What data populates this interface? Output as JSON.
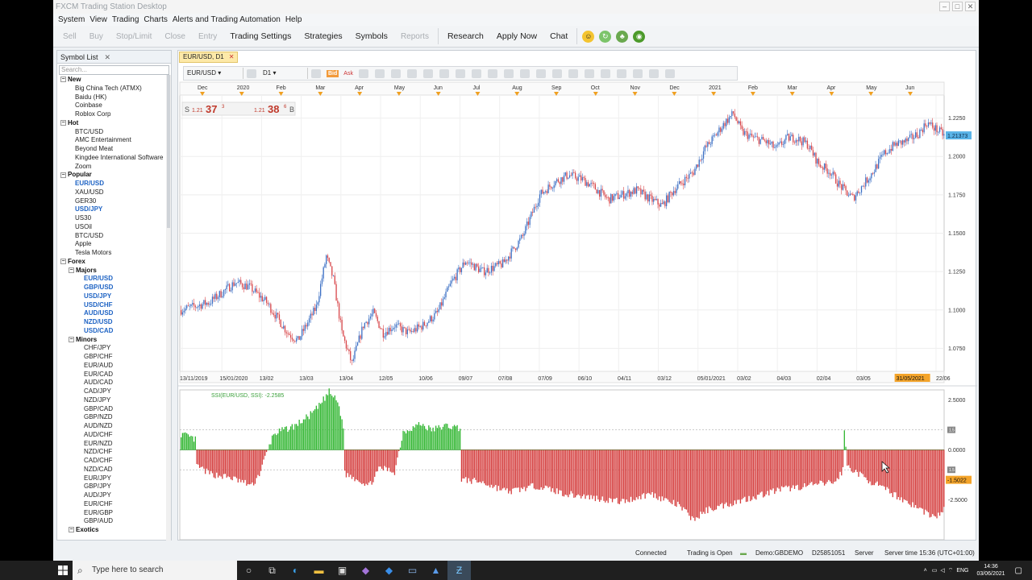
{
  "window": {
    "title": "FXCM Trading Station Desktop"
  },
  "menu": [
    "System",
    "View",
    "Trading",
    "Charts",
    "Alerts and Trading Automation",
    "Help"
  ],
  "toolbar": {
    "disabled": [
      "Sell",
      "Buy",
      "Stop/Limit",
      "Close",
      "Entry"
    ],
    "enabled1": [
      "Trading Settings",
      "Strategies",
      "Symbols"
    ],
    "disabled2": [
      "Reports"
    ],
    "enabled2": [
      "Research",
      "Apply Now",
      "Chat"
    ]
  },
  "symbol_list": {
    "tab": "Symbol List",
    "search_placeholder": "Search...",
    "tree": [
      {
        "label": "New",
        "level": 0,
        "group": true
      },
      {
        "label": "Big China Tech (ATMX)",
        "level": 2
      },
      {
        "label": "Baidu (HK)",
        "level": 2
      },
      {
        "label": "Coinbase",
        "level": 2
      },
      {
        "label": "Roblox Corp",
        "level": 2
      },
      {
        "label": "Hot",
        "level": 0,
        "group": true
      },
      {
        "label": "BTC/USD",
        "level": 2
      },
      {
        "label": "AMC Entertainment",
        "level": 2
      },
      {
        "label": "Beyond Meat",
        "level": 2
      },
      {
        "label": "Kingdee International Software",
        "level": 2
      },
      {
        "label": "Zoom",
        "level": 2
      },
      {
        "label": "Popular",
        "level": 0,
        "group": true
      },
      {
        "label": "EUR/USD",
        "level": 2,
        "hl": true
      },
      {
        "label": "XAU/USD",
        "level": 2
      },
      {
        "label": "GER30",
        "level": 2
      },
      {
        "label": "USD/JPY",
        "level": 2,
        "hl": true
      },
      {
        "label": "US30",
        "level": 2
      },
      {
        "label": "USOil",
        "level": 2
      },
      {
        "label": "BTC/USD",
        "level": 2
      },
      {
        "label": "Apple",
        "level": 2
      },
      {
        "label": "Tesla Motors",
        "level": 2
      },
      {
        "label": "Forex",
        "level": 0,
        "group": true
      },
      {
        "label": "Majors",
        "level": 1,
        "group": true
      },
      {
        "label": "EUR/USD",
        "level": 3,
        "hl": true
      },
      {
        "label": "GBP/USD",
        "level": 3,
        "hl": true
      },
      {
        "label": "USD/JPY",
        "level": 3,
        "hl": true
      },
      {
        "label": "USD/CHF",
        "level": 3,
        "hl": true
      },
      {
        "label": "AUD/USD",
        "level": 3,
        "hl": true
      },
      {
        "label": "NZD/USD",
        "level": 3,
        "hl": true
      },
      {
        "label": "USD/CAD",
        "level": 3,
        "hl": true
      },
      {
        "label": "Minors",
        "level": 1,
        "group": true
      },
      {
        "label": "CHF/JPY",
        "level": 3
      },
      {
        "label": "GBP/CHF",
        "level": 3
      },
      {
        "label": "EUR/AUD",
        "level": 3
      },
      {
        "label": "EUR/CAD",
        "level": 3
      },
      {
        "label": "AUD/CAD",
        "level": 3
      },
      {
        "label": "CAD/JPY",
        "level": 3
      },
      {
        "label": "NZD/JPY",
        "level": 3
      },
      {
        "label": "GBP/CAD",
        "level": 3
      },
      {
        "label": "GBP/NZD",
        "level": 3
      },
      {
        "label": "AUD/NZD",
        "level": 3
      },
      {
        "label": "AUD/CHF",
        "level": 3
      },
      {
        "label": "EUR/NZD",
        "level": 3
      },
      {
        "label": "NZD/CHF",
        "level": 3
      },
      {
        "label": "CAD/CHF",
        "level": 3
      },
      {
        "label": "NZD/CAD",
        "level": 3
      },
      {
        "label": "EUR/JPY",
        "level": 3
      },
      {
        "label": "GBP/JPY",
        "level": 3
      },
      {
        "label": "AUD/JPY",
        "level": 3
      },
      {
        "label": "EUR/CHF",
        "level": 3
      },
      {
        "label": "EUR/GBP",
        "level": 3
      },
      {
        "label": "GBP/AUD",
        "level": 3
      },
      {
        "label": "Exotics",
        "level": 1,
        "group": true
      }
    ]
  },
  "chart_window": {
    "tab": "EUR/USD, D1",
    "instrument": "EUR/USD",
    "timeframe": "D1",
    "bid_label": "Bid",
    "ask_label": "Ask",
    "sell_label": "S",
    "buy_label": "B",
    "sell_price_prefix": "1.21",
    "sell_price_big": "37",
    "sell_price_pip": "3",
    "buy_price_prefix": "1.21",
    "buy_price_big": "38",
    "buy_price_pip": "6",
    "current_price_tag": "1.21373",
    "date_tag": "31/05/2021",
    "indicator_label": "SSI(EUR/USD, SSI): -2.2585",
    "indicator_current_tag": "-1.5022",
    "ind_marker_upper": "1.5",
    "ind_marker_lower": "1.5"
  },
  "chart_data": {
    "type": "candlestick",
    "top_axis_labels": [
      "Dec",
      "2020",
      "Feb",
      "Mar",
      "Apr",
      "May",
      "Jun",
      "Jul",
      "Aug",
      "Sep",
      "Oct",
      "Nov",
      "Dec",
      "2021",
      "Feb",
      "Mar",
      "Apr",
      "May",
      "Jun"
    ],
    "bottom_axis_labels": [
      "13/11/2019",
      "15/01/2020",
      "13/02",
      "13/03",
      "13/04",
      "12/05",
      "10/06",
      "09/07",
      "07/08",
      "07/09",
      "06/10",
      "04/11",
      "03/12",
      "05/01/2021",
      "03/02",
      "04/03",
      "02/04",
      "03/05",
      "31/05/2021",
      "22/06"
    ],
    "y_ticks": [
      1.075,
      1.1,
      1.125,
      1.15,
      1.175,
      1.2,
      1.225
    ],
    "y_tick_labels": [
      "1.0750",
      "1.1000",
      "1.1250",
      "1.1500",
      "1.1750",
      "1.2000",
      "1.2250"
    ],
    "ylim": [
      1.06,
      1.24
    ],
    "price_keypoints": [
      [
        0,
        1.1
      ],
      [
        20,
        1.105
      ],
      [
        38,
        1.118
      ],
      [
        48,
        1.115
      ],
      [
        60,
        1.105
      ],
      [
        75,
        1.085
      ],
      [
        82,
        1.08
      ],
      [
        95,
        1.102
      ],
      [
        102,
        1.135
      ],
      [
        107,
        1.12
      ],
      [
        113,
        1.085
      ],
      [
        120,
        1.065
      ],
      [
        128,
        1.09
      ],
      [
        135,
        1.098
      ],
      [
        142,
        1.085
      ],
      [
        150,
        1.09
      ],
      [
        160,
        1.085
      ],
      [
        170,
        1.09
      ],
      [
        180,
        1.098
      ],
      [
        190,
        1.118
      ],
      [
        200,
        1.132
      ],
      [
        212,
        1.125
      ],
      [
        226,
        1.13
      ],
      [
        240,
        1.148
      ],
      [
        252,
        1.175
      ],
      [
        262,
        1.183
      ],
      [
        272,
        1.188
      ],
      [
        282,
        1.185
      ],
      [
        290,
        1.18
      ],
      [
        300,
        1.172
      ],
      [
        310,
        1.175
      ],
      [
        320,
        1.178
      ],
      [
        330,
        1.172
      ],
      [
        338,
        1.168
      ],
      [
        346,
        1.178
      ],
      [
        354,
        1.185
      ],
      [
        360,
        1.19
      ],
      [
        368,
        1.205
      ],
      [
        374,
        1.212
      ],
      [
        382,
        1.222
      ],
      [
        388,
        1.228
      ],
      [
        394,
        1.216
      ],
      [
        402,
        1.212
      ],
      [
        410,
        1.21
      ],
      [
        418,
        1.205
      ],
      [
        426,
        1.212
      ],
      [
        432,
        1.212
      ],
      [
        440,
        1.208
      ],
      [
        448,
        1.195
      ],
      [
        456,
        1.19
      ],
      [
        462,
        1.182
      ],
      [
        468,
        1.176
      ],
      [
        472,
        1.173
      ],
      [
        478,
        1.18
      ],
      [
        486,
        1.19
      ],
      [
        494,
        1.202
      ],
      [
        502,
        1.208
      ],
      [
        510,
        1.21
      ],
      [
        518,
        1.215
      ],
      [
        524,
        1.222
      ],
      [
        530,
        1.218
      ],
      [
        536,
        1.214
      ]
    ],
    "indicator": {
      "name": "SSI(EUR/USD, SSI)",
      "value": -2.2585,
      "current": -1.5022,
      "y_ticks": [
        2.5,
        0,
        -2.5
      ],
      "y_tick_labels": [
        "2.5000",
        "0.0000",
        "-2.5000"
      ],
      "ylim": [
        -4.5,
        3.0
      ],
      "keypoints": [
        [
          0,
          0.8
        ],
        [
          10,
          0.5
        ],
        [
          11,
          -0.8
        ],
        [
          20,
          -1.2
        ],
        [
          35,
          -1.4
        ],
        [
          50,
          -1.8
        ],
        [
          55,
          -1.2
        ],
        [
          65,
          0.8
        ],
        [
          80,
          1.2
        ],
        [
          90,
          1.7
        ],
        [
          96,
          2.1
        ],
        [
          104,
          2.9
        ],
        [
          110,
          2.4
        ],
        [
          114,
          1.2
        ],
        [
          115,
          -1.2
        ],
        [
          125,
          -1.5
        ],
        [
          132,
          -1.8
        ],
        [
          140,
          -0.9
        ],
        [
          150,
          -1.1
        ],
        [
          156,
          0.9
        ],
        [
          168,
          1.3
        ],
        [
          176,
          1.0
        ],
        [
          186,
          1.2
        ],
        [
          196,
          1.1
        ],
        [
          197,
          -1.5
        ],
        [
          210,
          -1.6
        ],
        [
          230,
          -2.1
        ],
        [
          250,
          -1.8
        ],
        [
          270,
          -2.2
        ],
        [
          290,
          -2.4
        ],
        [
          310,
          -2.6
        ],
        [
          330,
          -2.2
        ],
        [
          350,
          -2.8
        ],
        [
          360,
          -3.5
        ],
        [
          370,
          -3.0
        ],
        [
          380,
          -2.8
        ],
        [
          400,
          -2.4
        ],
        [
          420,
          -2.0
        ],
        [
          440,
          -1.8
        ],
        [
          460,
          -1.6
        ],
        [
          465,
          -1.0
        ],
        [
          466,
          1.0
        ],
        [
          468,
          -0.8
        ],
        [
          480,
          -1.4
        ],
        [
          500,
          -2.2
        ],
        [
          515,
          -2.8
        ],
        [
          530,
          -3.4
        ],
        [
          536,
          -3.0
        ]
      ]
    }
  },
  "statusbar": {
    "connected": "Connected",
    "trading": "Trading is Open",
    "account": "Demo:GBDEMO",
    "id": "D25851051",
    "server": "Server",
    "server_time": "Server time 15:36 (UTC+01:00)"
  },
  "taskbar": {
    "search_placeholder": "Type here to search",
    "lang": "ENG",
    "time": "14:36",
    "date": "03/06/2021"
  }
}
